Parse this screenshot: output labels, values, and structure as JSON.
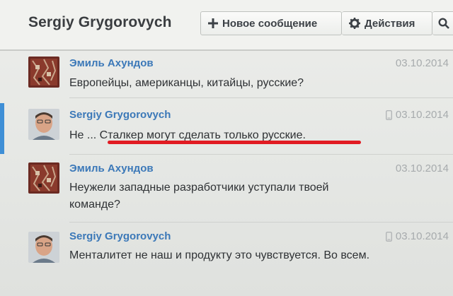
{
  "header": {
    "title": "Sergiy Grygorovych",
    "new_message_label": "Новое сообщение",
    "actions_label": "Действия"
  },
  "messages": [
    {
      "author": "Эмиль Ахундов",
      "date": "03.10.2014",
      "text": "Европейцы, американцы, китайцы, русские?",
      "mobile": false
    },
    {
      "author": "Sergiy Grygorovych",
      "date": "03.10.2014",
      "text": "Не ... Сталкер могут сделать только русские.",
      "mobile": true
    },
    {
      "author": "Эмиль Ахундов",
      "date": "03.10.2014",
      "text": "Неужели западные разработчики уступали твоей команде?",
      "mobile": false
    },
    {
      "author": "Sergiy Grygorovych",
      "date": "03.10.2014",
      "text": "Менталитет не наш и продукту это чувствуется. Во всем.",
      "mobile": true
    }
  ],
  "colors": {
    "accent": "#3f8fd6",
    "name": "#3b78b8",
    "highlight_underline": "#e11b22"
  },
  "icons": [
    "plus-icon",
    "gear-icon",
    "search-icon",
    "mobile-phone-icon"
  ]
}
